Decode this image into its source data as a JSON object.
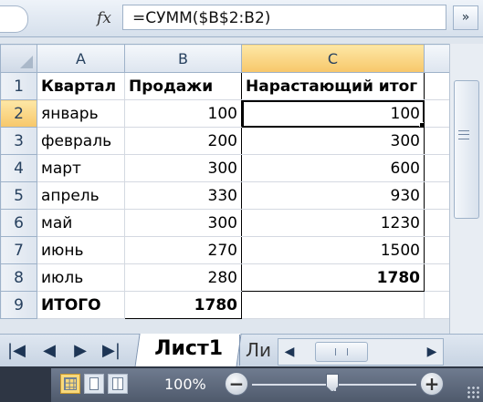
{
  "formula_bar": {
    "fx_label": "fx",
    "formula": "=СУММ($B$2:B2)",
    "expand_glyph": "»"
  },
  "grid": {
    "columns": [
      "A",
      "B",
      "C"
    ],
    "row_numbers": [
      "1",
      "2",
      "3",
      "4",
      "5",
      "6",
      "7",
      "8",
      "9"
    ],
    "header_row": {
      "a": "Квартал",
      "b": "Продажи",
      "c": "Нарастающий итог"
    },
    "rows": [
      {
        "a": "январь",
        "b": "100",
        "c": "100"
      },
      {
        "a": "февраль",
        "b": "200",
        "c": "300"
      },
      {
        "a": "март",
        "b": "300",
        "c": "600"
      },
      {
        "a": "апрель",
        "b": "330",
        "c": "930"
      },
      {
        "a": "май",
        "b": "300",
        "c": "1230"
      },
      {
        "a": "июнь",
        "b": "270",
        "c": "1500"
      },
      {
        "a": "июль",
        "b": "280",
        "c": "1780"
      }
    ],
    "total_row": {
      "a": "ИТОГО",
      "b": "1780",
      "c": ""
    },
    "active_cell": "C2"
  },
  "sheet_tabs": {
    "active": "Лист1",
    "next_partial": "Ли",
    "nav_glyphs": [
      "|◀",
      "◀",
      "▶",
      "▶|"
    ]
  },
  "status_bar": {
    "zoom_label": "100%",
    "zoom_minus": "−",
    "zoom_plus": "+",
    "zoom_level_percent": 100
  },
  "colors": {
    "selected_header": "#f7c76a",
    "header": "#dde5ef",
    "statusbar": "#4f5a6c"
  },
  "icons": [
    "fx-icon",
    "expand-formula-icon",
    "scroll-first-icon",
    "scroll-prev-icon",
    "scroll-next-icon",
    "scroll-last-icon",
    "normal-view-icon",
    "page-layout-icon",
    "page-break-icon",
    "zoom-out-icon",
    "zoom-in-icon"
  ]
}
